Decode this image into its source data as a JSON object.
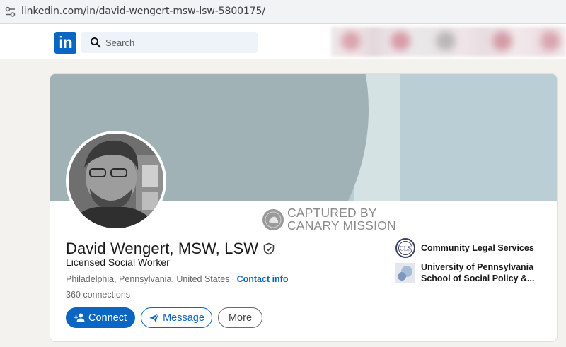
{
  "browser": {
    "url": "linkedin.com/in/david-wengert-msw-lsw-5800175/"
  },
  "nav": {
    "logo_text": "in",
    "search_placeholder": "Search"
  },
  "watermark": {
    "line1": "CAPTURED BY",
    "line2": "CANARY MISSION"
  },
  "profile": {
    "name": "David Wengert, MSW, LSW",
    "headline": "Licensed Social Worker",
    "location": "Philadelphia, Pennsylvania, United States",
    "separator": "·",
    "contact_link": "Contact info",
    "connections": "360 connections"
  },
  "actions": {
    "connect_label": "Connect",
    "message_label": "Message",
    "more_label": "More"
  },
  "organizations": [
    {
      "name": "Community Legal Services",
      "logo_text": "CLS"
    },
    {
      "name_line1": "University of Pennsylvania",
      "name_line2": "School of Social Policy &..."
    }
  ],
  "colors": {
    "brand": "#0a66c2",
    "page_bg": "#f3f2ef",
    "banner": "#bacfd5",
    "banner_shape": "#a1b2b6"
  }
}
